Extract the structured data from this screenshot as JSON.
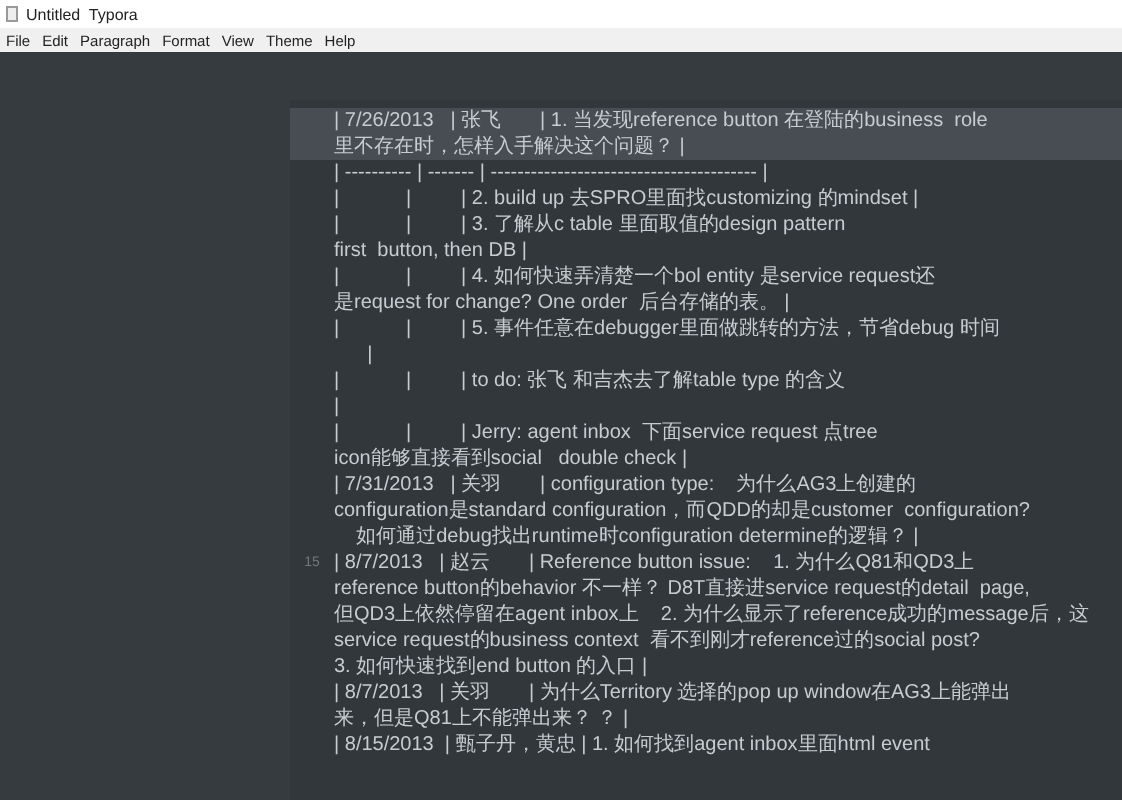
{
  "window": {
    "title": "Untitled  Typora"
  },
  "menu": [
    "File",
    "Edit",
    "Paragraph",
    "Format",
    "View",
    "Theme",
    "Help"
  ],
  "code_block": {
    "lines": [
      {
        "text": "| 7/26/2013   | 张飞       | 1. 当发现reference button 在登陆的business  role",
        "highlighted": true
      },
      {
        "text": "里不存在时，怎样入手解决这个问题？ |",
        "highlighted": true
      },
      {
        "text": "| ---------- | ------- | ---------------------------------------- |",
        "highlighted": false
      },
      {
        "text": "|            |         | 2. build up 去SPRO里面找customizing 的mindset |",
        "highlighted": false
      },
      {
        "text": "|            |         | 3. 了解从c table 里面取值的design pattern",
        "highlighted": false
      },
      {
        "text": "first  button, then DB |",
        "highlighted": false
      },
      {
        "text": "|            |         | 4. 如何快速弄清楚一个bol entity 是service request还",
        "highlighted": false
      },
      {
        "text": "是request for change? One order  后台存储的表。 |",
        "highlighted": false
      },
      {
        "text": "|            |         | 5. 事件任意在debugger里面做跳转的方法，节省debug 时间",
        "highlighted": false
      },
      {
        "text": "      |",
        "highlighted": false
      },
      {
        "text": "|            |         | to do: 张飞 和吉杰去了解table type 的含义",
        "highlighted": false
      },
      {
        "text": "|",
        "highlighted": false
      },
      {
        "text": "|            |         | Jerry: agent inbox  下面service request 点tree",
        "highlighted": false
      },
      {
        "text": "icon能够直接看到social   double check |",
        "highlighted": false
      },
      {
        "text": "| 7/31/2013   | 关羽       | configuration type:    为什么AG3上创建的",
        "highlighted": false
      },
      {
        "text": "configuration是standard configuration，而QDD的却是customer  configuration?",
        "highlighted": false
      },
      {
        "text": "    如何通过debug找出runtime时configuration determine的逻辑？ |",
        "highlighted": false
      },
      {
        "text": "| 8/7/2013   | 赵云       | Reference button issue:    1. 为什么Q81和QD3上",
        "gutter": "15",
        "highlighted": false
      },
      {
        "text": "reference button的behavior 不一样？ D8T直接进service request的detail  page,",
        "highlighted": false
      },
      {
        "text": "但QD3上依然停留在agent inbox上    2. 为什么显示了reference成功的message后，这",
        "highlighted": false
      },
      {
        "text": "service request的business context  看不到刚才reference过的social post?",
        "highlighted": false
      },
      {
        "text": "3. 如何快速找到end button 的入口 |",
        "highlighted": false
      },
      {
        "text": "| 8/7/2013   | 关羽       | 为什么Territory 选择的pop up window在AG3上能弹出",
        "highlighted": false
      },
      {
        "text": "来，但是Q81上不能弹出来？ ？ |",
        "highlighted": false
      },
      {
        "text": "| 8/15/2013  | 甄子丹，黄忠 | 1. 如何找到agent inbox里面html event",
        "highlighted": false
      }
    ]
  }
}
